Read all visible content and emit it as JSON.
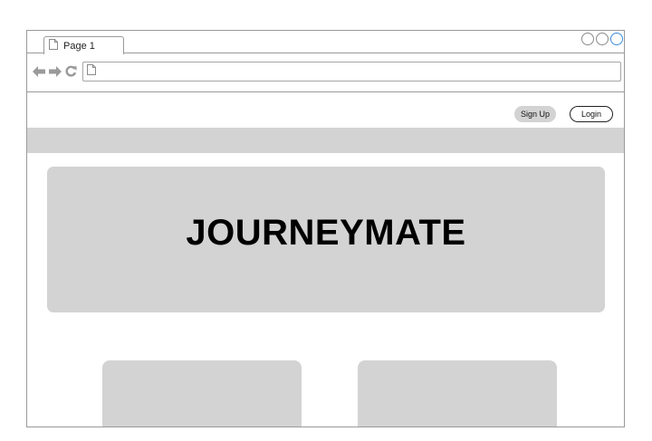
{
  "browser": {
    "tab_title": "Page 1",
    "icons": {
      "tab": "page-icon",
      "back": "back-arrow-icon",
      "forward": "forward-arrow-icon",
      "reload": "reload-icon",
      "address": "page-icon"
    },
    "address_value": ""
  },
  "header": {
    "signup_label": "Sign Up",
    "login_label": "Login"
  },
  "hero": {
    "title": "JOURNEYMATE"
  },
  "colors": {
    "placeholder_gray": "#d3d3d3",
    "window_border": "#9a9a9a",
    "active_control": "#3b8ede"
  }
}
